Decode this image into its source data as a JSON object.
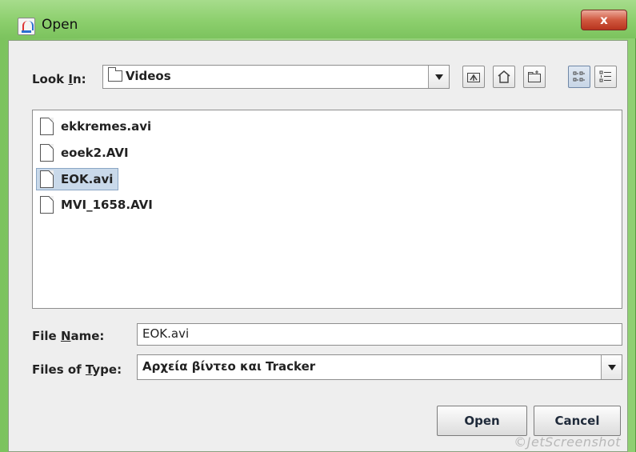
{
  "window": {
    "title": "Open",
    "close_label": "x"
  },
  "look_in": {
    "label_pre": "Look ",
    "label_mnemonic": "I",
    "label_post": "n:",
    "value": "Videos"
  },
  "files": [
    {
      "name": "ekkremes.avi",
      "selected": false
    },
    {
      "name": "eoek2.AVI",
      "selected": false
    },
    {
      "name": "EOK.avi",
      "selected": true
    },
    {
      "name": "MVI_1658.AVI",
      "selected": false
    }
  ],
  "file_name": {
    "label_pre": "File ",
    "label_mnemonic": "N",
    "label_post": "ame:",
    "value": "EOK.avi"
  },
  "file_type": {
    "label_pre": "Files of ",
    "label_mnemonic": "T",
    "label_post": "ype:",
    "value": "Αρχεία βίντεο και Tracker"
  },
  "buttons": {
    "open": "Open",
    "cancel": "Cancel"
  },
  "watermark": "©JetScreenshot",
  "icons": [
    "app-java-icon",
    "close-icon",
    "folder-icon",
    "up-one-level-icon",
    "home-icon",
    "new-folder-icon",
    "list-view-icon",
    "details-view-icon",
    "file-icon",
    "chevron-down-icon"
  ]
}
